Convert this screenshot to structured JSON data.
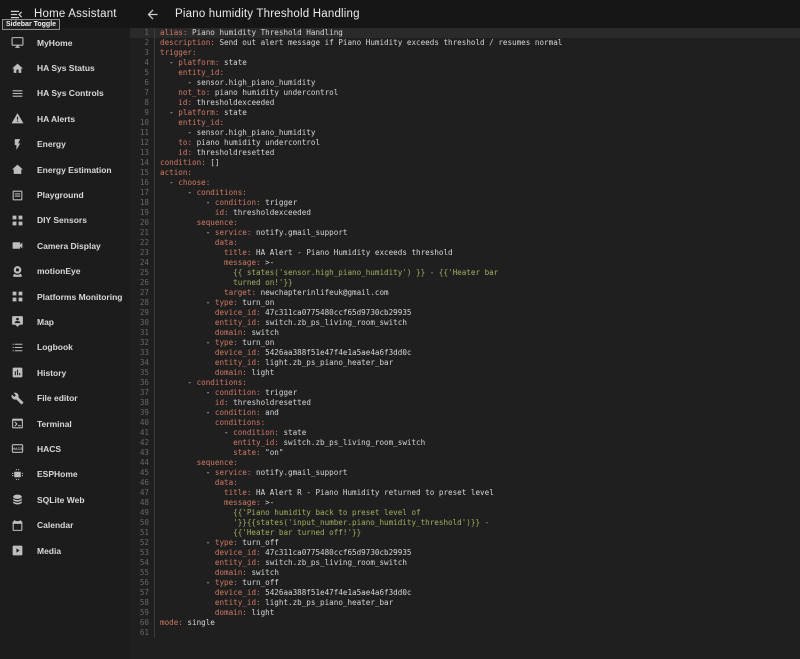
{
  "colors": {
    "topbar_bg": "#161616",
    "sidebar_bg": "#1c1c1c",
    "editor_bg": "#1f1f1f",
    "active_line_bg": "#2a2a2a",
    "key": "#cf7966",
    "value": "#d6d6d6",
    "string": "#a3ad5e",
    "line_number": "#606a66"
  },
  "sidebar": {
    "title": "Home Assistant",
    "toggle_icon": "menu-open-icon",
    "toggle_tooltip": "Sidebar Toggle",
    "items": [
      {
        "icon": "monitor-icon",
        "label": "MyHome"
      },
      {
        "icon": "home-icon",
        "label": "HA Sys Status"
      },
      {
        "icon": "menu-icon",
        "label": "HA Sys Controls"
      },
      {
        "icon": "alert-icon",
        "label": "HA Alerts"
      },
      {
        "icon": "flash-icon",
        "label": "Energy"
      },
      {
        "icon": "house-icon",
        "label": "Energy Estimation"
      },
      {
        "icon": "card-icon",
        "label": "Playground"
      },
      {
        "icon": "grid-icon",
        "label": "DIY Sensors"
      },
      {
        "icon": "video-icon",
        "label": "Camera Display"
      },
      {
        "icon": "webcam-icon",
        "label": "motionEye"
      },
      {
        "icon": "grid-icon",
        "label": "Platforms Monitoring"
      },
      {
        "icon": "map-icon",
        "label": "Map"
      },
      {
        "icon": "list-icon",
        "label": "Logbook"
      },
      {
        "icon": "chart-icon",
        "label": "History"
      },
      {
        "icon": "wrench-icon",
        "label": "File editor"
      },
      {
        "icon": "console-icon",
        "label": "Terminal"
      },
      {
        "icon": "hacs-icon",
        "label": "HACS"
      },
      {
        "icon": "chip-icon",
        "label": "ESPHome"
      },
      {
        "icon": "database-icon",
        "label": "SQLite Web"
      },
      {
        "icon": "calendar-icon",
        "label": "Calendar"
      },
      {
        "icon": "media-icon",
        "label": "Media"
      }
    ]
  },
  "header": {
    "back_icon": "arrow-left-icon",
    "title": "Piano humidity Threshold Handling"
  },
  "editor": {
    "active_line": 1,
    "lines": [
      [
        [
          "k",
          "alias:"
        ],
        [
          "v",
          " Piano humidity Threshold Handling"
        ]
      ],
      [
        [
          "k",
          "description:"
        ],
        [
          "v",
          " Send out alert message if Piano Humidity exceeds threshold / resumes normal"
        ]
      ],
      [
        [
          "k",
          "trigger:"
        ]
      ],
      [
        [
          "v",
          "  - "
        ],
        [
          "k",
          "platform:"
        ],
        [
          "v",
          " state"
        ]
      ],
      [
        [
          "v",
          "    "
        ],
        [
          "k",
          "entity_id:"
        ]
      ],
      [
        [
          "v",
          "      - sensor.high_piano_humidity"
        ]
      ],
      [
        [
          "v",
          "    "
        ],
        [
          "k",
          "not_to:"
        ],
        [
          "v",
          " piano humidity undercontrol"
        ]
      ],
      [
        [
          "v",
          "    "
        ],
        [
          "k",
          "id:"
        ],
        [
          "v",
          " thresholdexceeded"
        ]
      ],
      [
        [
          "v",
          "  - "
        ],
        [
          "k",
          "platform:"
        ],
        [
          "v",
          " state"
        ]
      ],
      [
        [
          "v",
          "    "
        ],
        [
          "k",
          "entity_id:"
        ]
      ],
      [
        [
          "v",
          "      - sensor.high_piano_humidity"
        ]
      ],
      [
        [
          "v",
          "    "
        ],
        [
          "k",
          "to:"
        ],
        [
          "v",
          " piano humidity undercontrol"
        ]
      ],
      [
        [
          "v",
          "    "
        ],
        [
          "k",
          "id:"
        ],
        [
          "v",
          " thresholdresetted"
        ]
      ],
      [
        [
          "k",
          "condition:"
        ],
        [
          "v",
          " []"
        ]
      ],
      [
        [
          "k",
          "action:"
        ]
      ],
      [
        [
          "v",
          "  - "
        ],
        [
          "k",
          "choose:"
        ]
      ],
      [
        [
          "v",
          "      - "
        ],
        [
          "k",
          "conditions:"
        ]
      ],
      [
        [
          "v",
          "          - "
        ],
        [
          "k",
          "condition:"
        ],
        [
          "v",
          " trigger"
        ]
      ],
      [
        [
          "v",
          "            "
        ],
        [
          "k",
          "id:"
        ],
        [
          "v",
          " thresholdexceeded"
        ]
      ],
      [
        [
          "v",
          "        "
        ],
        [
          "k",
          "sequence:"
        ]
      ],
      [
        [
          "v",
          "          - "
        ],
        [
          "k",
          "service:"
        ],
        [
          "v",
          " notify.gmail_support"
        ]
      ],
      [
        [
          "v",
          "            "
        ],
        [
          "k",
          "data:"
        ]
      ],
      [
        [
          "v",
          "              "
        ],
        [
          "k",
          "title:"
        ],
        [
          "v",
          " HA Alert - Piano Humidity exceeds threshold"
        ]
      ],
      [
        [
          "v",
          "              "
        ],
        [
          "k",
          "message:"
        ],
        [
          "v",
          " >-"
        ]
      ],
      [
        [
          "s",
          "                {{ states('sensor.high_piano_humidity') }} - {{'Heater bar"
        ]
      ],
      [
        [
          "s",
          "                turned on!'}}"
        ]
      ],
      [
        [
          "v",
          "              "
        ],
        [
          "k",
          "target:"
        ],
        [
          "v",
          " newchapterinlifeuk@gmail.com"
        ]
      ],
      [
        [
          "v",
          "          - "
        ],
        [
          "k",
          "type:"
        ],
        [
          "v",
          " turn_on"
        ]
      ],
      [
        [
          "v",
          "            "
        ],
        [
          "k",
          "device_id:"
        ],
        [
          "v",
          " 47c311ca0775480ccf65d9730cb29935"
        ]
      ],
      [
        [
          "v",
          "            "
        ],
        [
          "k",
          "entity_id:"
        ],
        [
          "v",
          " switch.zb_ps_living_room_switch"
        ]
      ],
      [
        [
          "v",
          "            "
        ],
        [
          "k",
          "domain:"
        ],
        [
          "v",
          " switch"
        ]
      ],
      [
        [
          "v",
          "          - "
        ],
        [
          "k",
          "type:"
        ],
        [
          "v",
          " turn_on"
        ]
      ],
      [
        [
          "v",
          "            "
        ],
        [
          "k",
          "device_id:"
        ],
        [
          "v",
          " 5426aa388f51e47f4e1a5ae4a6f3dd0c"
        ]
      ],
      [
        [
          "v",
          "            "
        ],
        [
          "k",
          "entity_id:"
        ],
        [
          "v",
          " light.zb_ps_piano_heater_bar"
        ]
      ],
      [
        [
          "v",
          "            "
        ],
        [
          "k",
          "domain:"
        ],
        [
          "v",
          " light"
        ]
      ],
      [
        [
          "v",
          "      - "
        ],
        [
          "k",
          "conditions:"
        ]
      ],
      [
        [
          "v",
          "          - "
        ],
        [
          "k",
          "condition:"
        ],
        [
          "v",
          " trigger"
        ]
      ],
      [
        [
          "v",
          "            "
        ],
        [
          "k",
          "id:"
        ],
        [
          "v",
          " thresholdresetted"
        ]
      ],
      [
        [
          "v",
          "          - "
        ],
        [
          "k",
          "condition:"
        ],
        [
          "v",
          " and"
        ]
      ],
      [
        [
          "v",
          "            "
        ],
        [
          "k",
          "conditions:"
        ]
      ],
      [
        [
          "v",
          "              - "
        ],
        [
          "k",
          "condition:"
        ],
        [
          "v",
          " state"
        ]
      ],
      [
        [
          "v",
          "                "
        ],
        [
          "k",
          "entity_id:"
        ],
        [
          "v",
          " switch.zb_ps_living_room_switch"
        ]
      ],
      [
        [
          "v",
          "                "
        ],
        [
          "k",
          "state:"
        ],
        [
          "v",
          " \"on\""
        ]
      ],
      [
        [
          "v",
          "        "
        ],
        [
          "k",
          "sequence:"
        ]
      ],
      [
        [
          "v",
          "          - "
        ],
        [
          "k",
          "service:"
        ],
        [
          "v",
          " notify.gmail_support"
        ]
      ],
      [
        [
          "v",
          "            "
        ],
        [
          "k",
          "data:"
        ]
      ],
      [
        [
          "v",
          "              "
        ],
        [
          "k",
          "title:"
        ],
        [
          "v",
          " HA Alert R - Piano Humidity returned to preset level"
        ]
      ],
      [
        [
          "v",
          "              "
        ],
        [
          "k",
          "message:"
        ],
        [
          "v",
          " >-"
        ]
      ],
      [
        [
          "s",
          "                {{'Piano humidity back to preset level of"
        ]
      ],
      [
        [
          "s",
          "                '}}{{states('input_number.piano_humidity_threshold')}} -"
        ]
      ],
      [
        [
          "s",
          "                {{'Heater bar turned off!'}}"
        ]
      ],
      [
        [
          "v",
          "          - "
        ],
        [
          "k",
          "type:"
        ],
        [
          "v",
          " turn_off"
        ]
      ],
      [
        [
          "v",
          "            "
        ],
        [
          "k",
          "device_id:"
        ],
        [
          "v",
          " 47c311ca0775480ccf65d9730cb29935"
        ]
      ],
      [
        [
          "v",
          "            "
        ],
        [
          "k",
          "entity_id:"
        ],
        [
          "v",
          " switch.zb_ps_living_room_switch"
        ]
      ],
      [
        [
          "v",
          "            "
        ],
        [
          "k",
          "domain:"
        ],
        [
          "v",
          " switch"
        ]
      ],
      [
        [
          "v",
          "          - "
        ],
        [
          "k",
          "type:"
        ],
        [
          "v",
          " turn_off"
        ]
      ],
      [
        [
          "v",
          "            "
        ],
        [
          "k",
          "device_id:"
        ],
        [
          "v",
          " 5426aa388f51e47f4e1a5ae4a6f3dd0c"
        ]
      ],
      [
        [
          "v",
          "            "
        ],
        [
          "k",
          "entity_id:"
        ],
        [
          "v",
          " light.zb_ps_piano_heater_bar"
        ]
      ],
      [
        [
          "v",
          "            "
        ],
        [
          "k",
          "domain:"
        ],
        [
          "v",
          " light"
        ]
      ],
      [
        [
          "k",
          "mode:"
        ],
        [
          "v",
          " single"
        ]
      ],
      []
    ]
  }
}
